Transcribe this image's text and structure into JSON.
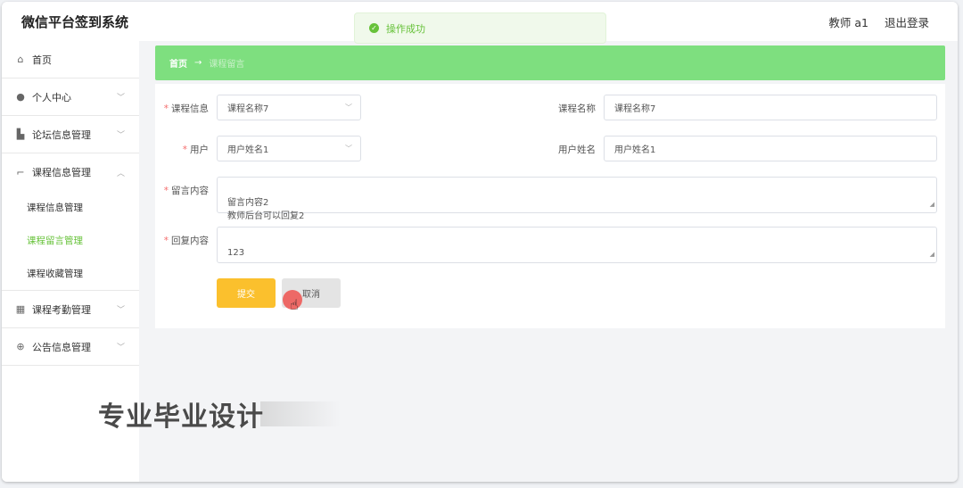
{
  "header": {
    "app_title": "微信平台签到系统",
    "user": "教师 a1",
    "logout": "退出登录"
  },
  "toast": {
    "icon": "check-circle-icon",
    "message": "操作成功"
  },
  "sidebar": {
    "items": [
      {
        "label": "首页",
        "icon": "home-icon"
      },
      {
        "label": "个人中心",
        "icon": "user-icon"
      },
      {
        "label": "论坛信息管理",
        "icon": "chart-icon"
      },
      {
        "label": "课程信息管理",
        "icon": "crop-icon"
      },
      {
        "label": "课程考勤管理",
        "icon": "grid-icon"
      },
      {
        "label": "公告信息管理",
        "icon": "compass-icon"
      }
    ],
    "submenu": [
      {
        "label": "课程信息管理"
      },
      {
        "label": "课程留言管理"
      },
      {
        "label": "课程收藏管理"
      }
    ]
  },
  "breadcrumb": {
    "home": "首页",
    "arrow": "→",
    "current": "课程留言"
  },
  "form": {
    "course_info_label": "课程信息",
    "course_info_value": "课程名称7",
    "course_name_label": "课程名称",
    "course_name_value": "课程名称7",
    "user_label": "用户",
    "user_value": "用户姓名1",
    "user_name_label": "用户姓名",
    "user_name_value": "用户姓名1",
    "message_label": "留言内容",
    "message_value": "留言内容2\n教师后台可以回复2",
    "reply_label": "回复内容",
    "reply_value": "123",
    "submit": "提交",
    "cancel": "取消"
  },
  "watermark": "专业毕业设计",
  "colors": {
    "accent_green": "#7edf7f",
    "active_green": "#67c23a",
    "submit_yellow": "#fbc02d",
    "required_red": "#f56c6c"
  }
}
